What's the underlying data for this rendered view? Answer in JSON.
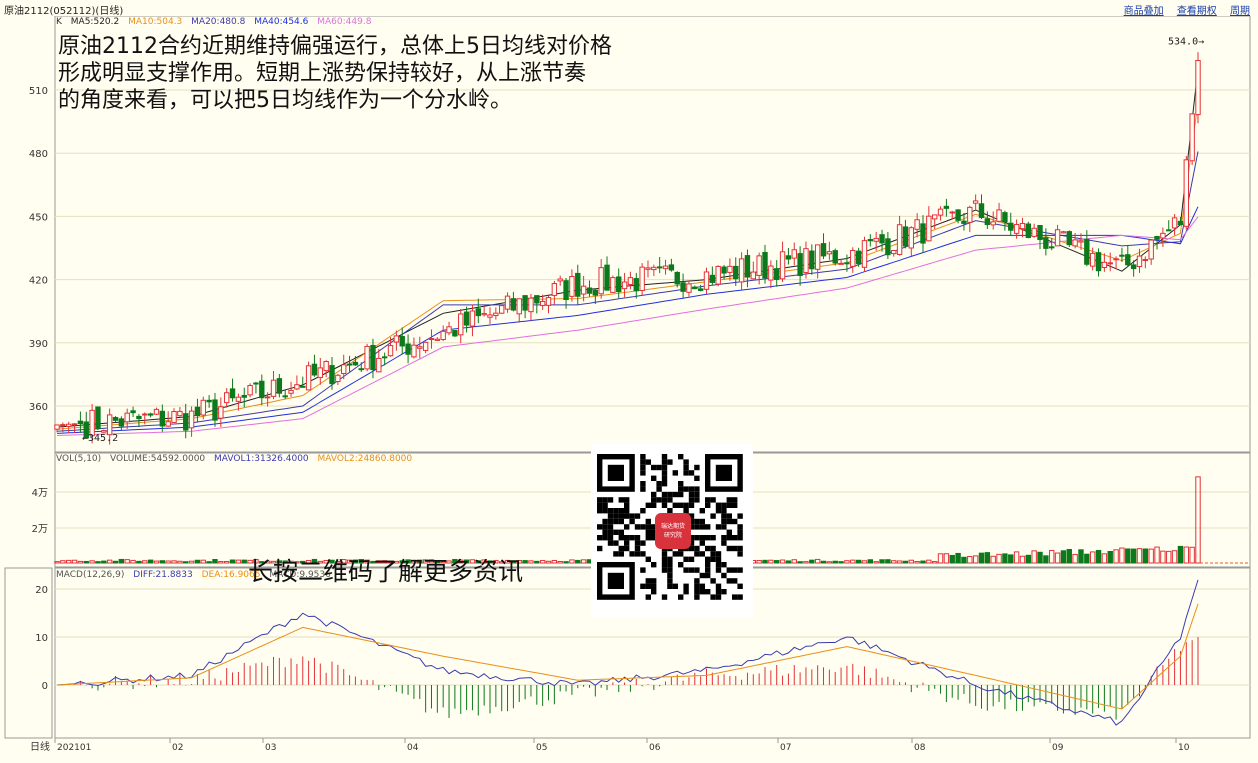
{
  "window": {
    "title": "原油2112(052112)(日线)",
    "links": [
      "商品叠加",
      "查看期权",
      "周期"
    ]
  },
  "annotation": {
    "lines": [
      "原油2112合约近期维持偏强运行，总体上5日均线对价格",
      "形成明显支撑作用。短期上涨势保持较好，从上涨节奏",
      "的角度来看，可以把5日均线作为一个分水岭。"
    ]
  },
  "qr_caption": "长按二维码了解更多资讯",
  "qr_logo_text": [
    "瑞达期货",
    "研究院"
  ],
  "price_panel": {
    "label": "K",
    "legend": [
      {
        "text": "MA5:520.2",
        "color": "#222222"
      },
      {
        "text": "MA10:504.3",
        "color": "#e8901a"
      },
      {
        "text": "MA20:480.8",
        "color": "#3b3bb0"
      },
      {
        "text": "MA40:454.6",
        "color": "#2030e0"
      },
      {
        "text": "MA60:449.8",
        "color": "#e070e0"
      }
    ],
    "high_label": "534.0",
    "low_label": "345.2",
    "yticks": [
      "510",
      "480",
      "450",
      "420",
      "390",
      "360"
    ]
  },
  "volume_panel": {
    "legend": [
      {
        "text": "VOL(5,10)",
        "color": "#555555"
      },
      {
        "text": "VOLUME:54592.0000",
        "color": "#555555"
      },
      {
        "text": "MAVOL1:31326.4000",
        "color": "#3b3bb0"
      },
      {
        "text": "MAVOL2:24860.8000",
        "color": "#e8901a"
      }
    ],
    "yticks": [
      "4万",
      "2万"
    ]
  },
  "macd_panel": {
    "legend": [
      {
        "text": "MACD(12,26,9)",
        "color": "#555555"
      },
      {
        "text": "DIFF:21.8833",
        "color": "#3b3bb0"
      },
      {
        "text": "DEA:16.9065",
        "color": "#e8901a"
      },
      {
        "text": "MACD:9.9536",
        "color": "#555555"
      }
    ],
    "yticks": [
      "20",
      "10",
      "0"
    ]
  },
  "x_axis": {
    "label": "日线",
    "ticks": [
      "202101",
      "02",
      "03",
      "04",
      "05",
      "06",
      "07",
      "08",
      "09",
      "10"
    ]
  },
  "colors": {
    "up": "#e2323a",
    "down": "#0c7a1c",
    "grid": "#e6e0c0",
    "ma5": "#222222",
    "ma10": "#e8901a",
    "ma20": "#3b3bb0",
    "ma40": "#2030e0",
    "ma60": "#e070e0",
    "diff": "#3b3bb0",
    "dea": "#e8901a"
  },
  "chart_data": {
    "type": "line",
    "title": "原油2112(052112)(日线)",
    "xlabel": "日线",
    "ylabel": "",
    "ylim": [
      345,
      536
    ],
    "x": [
      "202101",
      "02",
      "03",
      "04",
      "05",
      "06",
      "07",
      "08",
      "09",
      "10",
      "10(end)"
    ],
    "series": [
      {
        "name": "K (close, approx.)",
        "values": [
          351,
          355,
          372,
          395,
          418,
          422,
          432,
          452,
          425,
          448,
          524
        ]
      },
      {
        "name": "MA5",
        "values": [
          350,
          355,
          370,
          404,
          415,
          420,
          430,
          453,
          424,
          446,
          520.2
        ]
      },
      {
        "name": "MA10",
        "values": [
          349,
          354,
          365,
          410,
          411,
          419,
          428,
          451,
          429,
          442,
          504.3
        ]
      },
      {
        "name": "MA20",
        "values": [
          348,
          352,
          360,
          408,
          408,
          417,
          425,
          448,
          436,
          438,
          480.8
        ]
      },
      {
        "name": "MA40",
        "values": [
          347,
          350,
          357,
          396,
          403,
          413,
          421,
          441,
          441,
          437,
          454.6
        ]
      },
      {
        "name": "MA60",
        "values": [
          346,
          348,
          354,
          388,
          396,
          406,
          416,
          434,
          441,
          439,
          449.8
        ]
      }
    ],
    "high": 534.0,
    "low": 345.2,
    "volume": {
      "last": 54592.0,
      "mavol1": 31326.4,
      "mavol2": 24860.8
    },
    "macd": {
      "diff": 21.8833,
      "dea": 16.9065,
      "macd": 9.9536,
      "ylim": [
        -10,
        25
      ]
    }
  }
}
